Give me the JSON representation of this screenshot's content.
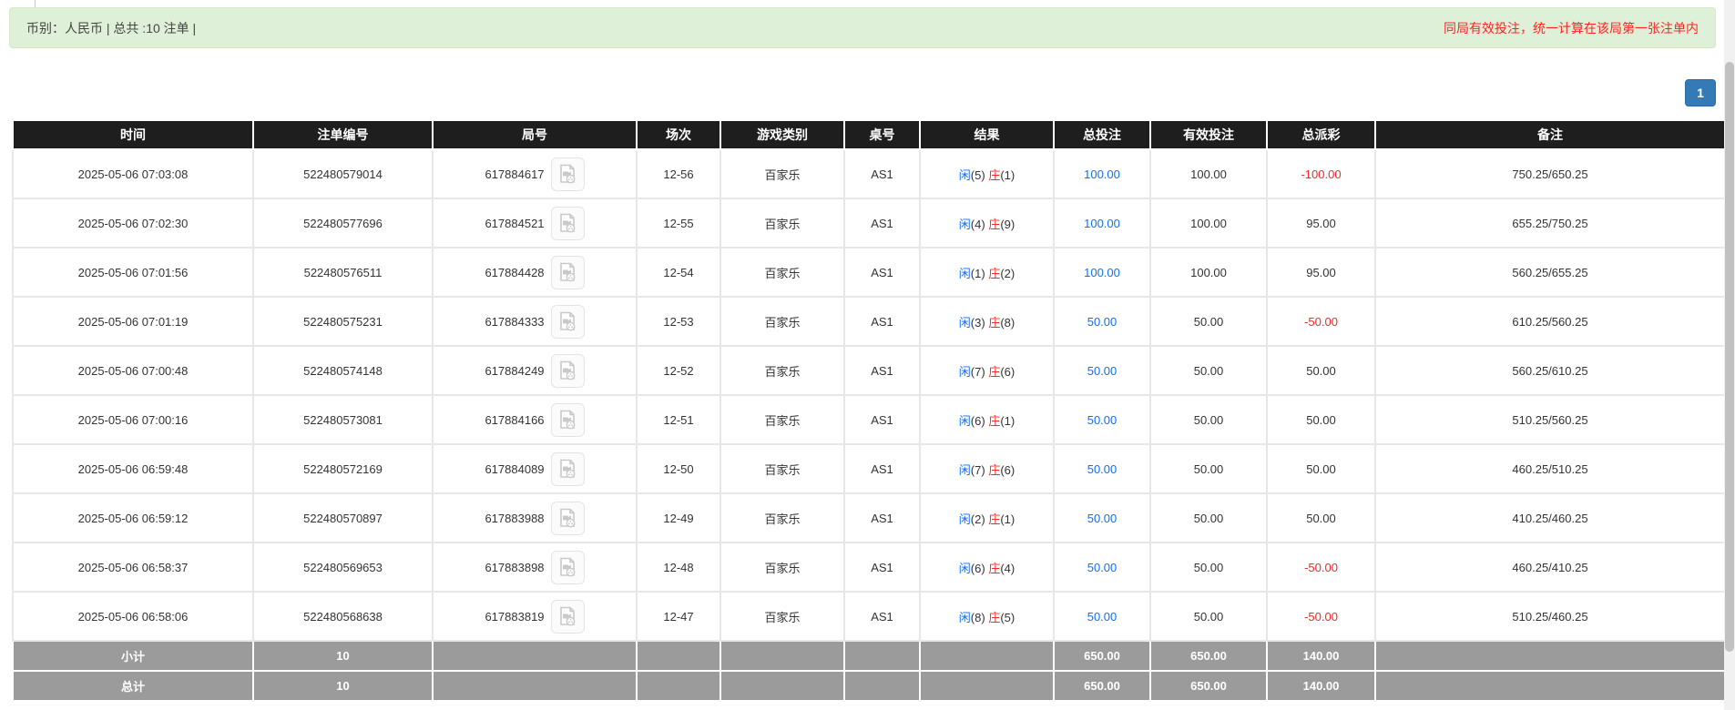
{
  "notice": {
    "left_text": "币别：人民币 | 总共 :10 注单 |",
    "right_text": "同局有效投注，统一计算在该局第一张注单内"
  },
  "pagination": {
    "current_page": "1"
  },
  "icons": {
    "round_column_icon": "video-replay"
  },
  "colors": {
    "notice_bg": "#dff0d8",
    "header_bg": "#1e1e1e",
    "summary_bg": "#9b9b9b",
    "accent_blue": "#0d6efd",
    "negative_red": "#ff2424",
    "pagination_bg": "#337ab7"
  },
  "table": {
    "headers": [
      "时间",
      "注单编号",
      "局号",
      "场次",
      "游戏类别",
      "桌号",
      "结果",
      "总投注",
      "有效投注",
      "总派彩",
      "备注"
    ],
    "rows": [
      {
        "time": "2025-05-06 07:03:08",
        "bet_id": "522480579014",
        "round_id": "617884617",
        "session": "12-56",
        "game_type": "百家乐",
        "table_no": "AS1",
        "result_player": "闲",
        "result_player_n": "(5)",
        "result_banker": "庄",
        "result_banker_n": "(1)",
        "total_bet": "100.00",
        "valid_bet": "100.00",
        "payout": "-100.00",
        "remark": "750.25/650.25"
      },
      {
        "time": "2025-05-06 07:02:30",
        "bet_id": "522480577696",
        "round_id": "617884521",
        "session": "12-55",
        "game_type": "百家乐",
        "table_no": "AS1",
        "result_player": "闲",
        "result_player_n": "(4)",
        "result_banker": "庄",
        "result_banker_n": "(9)",
        "total_bet": "100.00",
        "valid_bet": "100.00",
        "payout": "95.00",
        "remark": "655.25/750.25"
      },
      {
        "time": "2025-05-06 07:01:56",
        "bet_id": "522480576511",
        "round_id": "617884428",
        "session": "12-54",
        "game_type": "百家乐",
        "table_no": "AS1",
        "result_player": "闲",
        "result_player_n": "(1)",
        "result_banker": "庄",
        "result_banker_n": "(2)",
        "total_bet": "100.00",
        "valid_bet": "100.00",
        "payout": "95.00",
        "remark": "560.25/655.25"
      },
      {
        "time": "2025-05-06 07:01:19",
        "bet_id": "522480575231",
        "round_id": "617884333",
        "session": "12-53",
        "game_type": "百家乐",
        "table_no": "AS1",
        "result_player": "闲",
        "result_player_n": "(3)",
        "result_banker": "庄",
        "result_banker_n": "(8)",
        "total_bet": "50.00",
        "valid_bet": "50.00",
        "payout": "-50.00",
        "remark": "610.25/560.25"
      },
      {
        "time": "2025-05-06 07:00:48",
        "bet_id": "522480574148",
        "round_id": "617884249",
        "session": "12-52",
        "game_type": "百家乐",
        "table_no": "AS1",
        "result_player": "闲",
        "result_player_n": "(7)",
        "result_banker": "庄",
        "result_banker_n": "(6)",
        "total_bet": "50.00",
        "valid_bet": "50.00",
        "payout": "50.00",
        "remark": "560.25/610.25"
      },
      {
        "time": "2025-05-06 07:00:16",
        "bet_id": "522480573081",
        "round_id": "617884166",
        "session": "12-51",
        "game_type": "百家乐",
        "table_no": "AS1",
        "result_player": "闲",
        "result_player_n": "(6)",
        "result_banker": "庄",
        "result_banker_n": "(1)",
        "total_bet": "50.00",
        "valid_bet": "50.00",
        "payout": "50.00",
        "remark": "510.25/560.25"
      },
      {
        "time": "2025-05-06 06:59:48",
        "bet_id": "522480572169",
        "round_id": "617884089",
        "session": "12-50",
        "game_type": "百家乐",
        "table_no": "AS1",
        "result_player": "闲",
        "result_player_n": "(7)",
        "result_banker": "庄",
        "result_banker_n": "(6)",
        "total_bet": "50.00",
        "valid_bet": "50.00",
        "payout": "50.00",
        "remark": "460.25/510.25"
      },
      {
        "time": "2025-05-06 06:59:12",
        "bet_id": "522480570897",
        "round_id": "617883988",
        "session": "12-49",
        "game_type": "百家乐",
        "table_no": "AS1",
        "result_player": "闲",
        "result_player_n": "(2)",
        "result_banker": "庄",
        "result_banker_n": "(1)",
        "total_bet": "50.00",
        "valid_bet": "50.00",
        "payout": "50.00",
        "remark": "410.25/460.25"
      },
      {
        "time": "2025-05-06 06:58:37",
        "bet_id": "522480569653",
        "round_id": "617883898",
        "session": "12-48",
        "game_type": "百家乐",
        "table_no": "AS1",
        "result_player": "闲",
        "result_player_n": "(6)",
        "result_banker": "庄",
        "result_banker_n": "(4)",
        "total_bet": "50.00",
        "valid_bet": "50.00",
        "payout": "-50.00",
        "remark": "460.25/410.25"
      },
      {
        "time": "2025-05-06 06:58:06",
        "bet_id": "522480568638",
        "round_id": "617883819",
        "session": "12-47",
        "game_type": "百家乐",
        "table_no": "AS1",
        "result_player": "闲",
        "result_player_n": "(8)",
        "result_banker": "庄",
        "result_banker_n": "(5)",
        "total_bet": "50.00",
        "valid_bet": "50.00",
        "payout": "-50.00",
        "remark": "510.25/460.25"
      }
    ],
    "summary_rows": [
      {
        "label": "小计",
        "count": "10",
        "total_bet": "650.00",
        "valid_bet": "650.00",
        "payout": "140.00",
        "remark": ""
      },
      {
        "label": "总计",
        "count": "10",
        "total_bet": "650.00",
        "valid_bet": "650.00",
        "payout": "140.00",
        "remark": ""
      }
    ]
  }
}
